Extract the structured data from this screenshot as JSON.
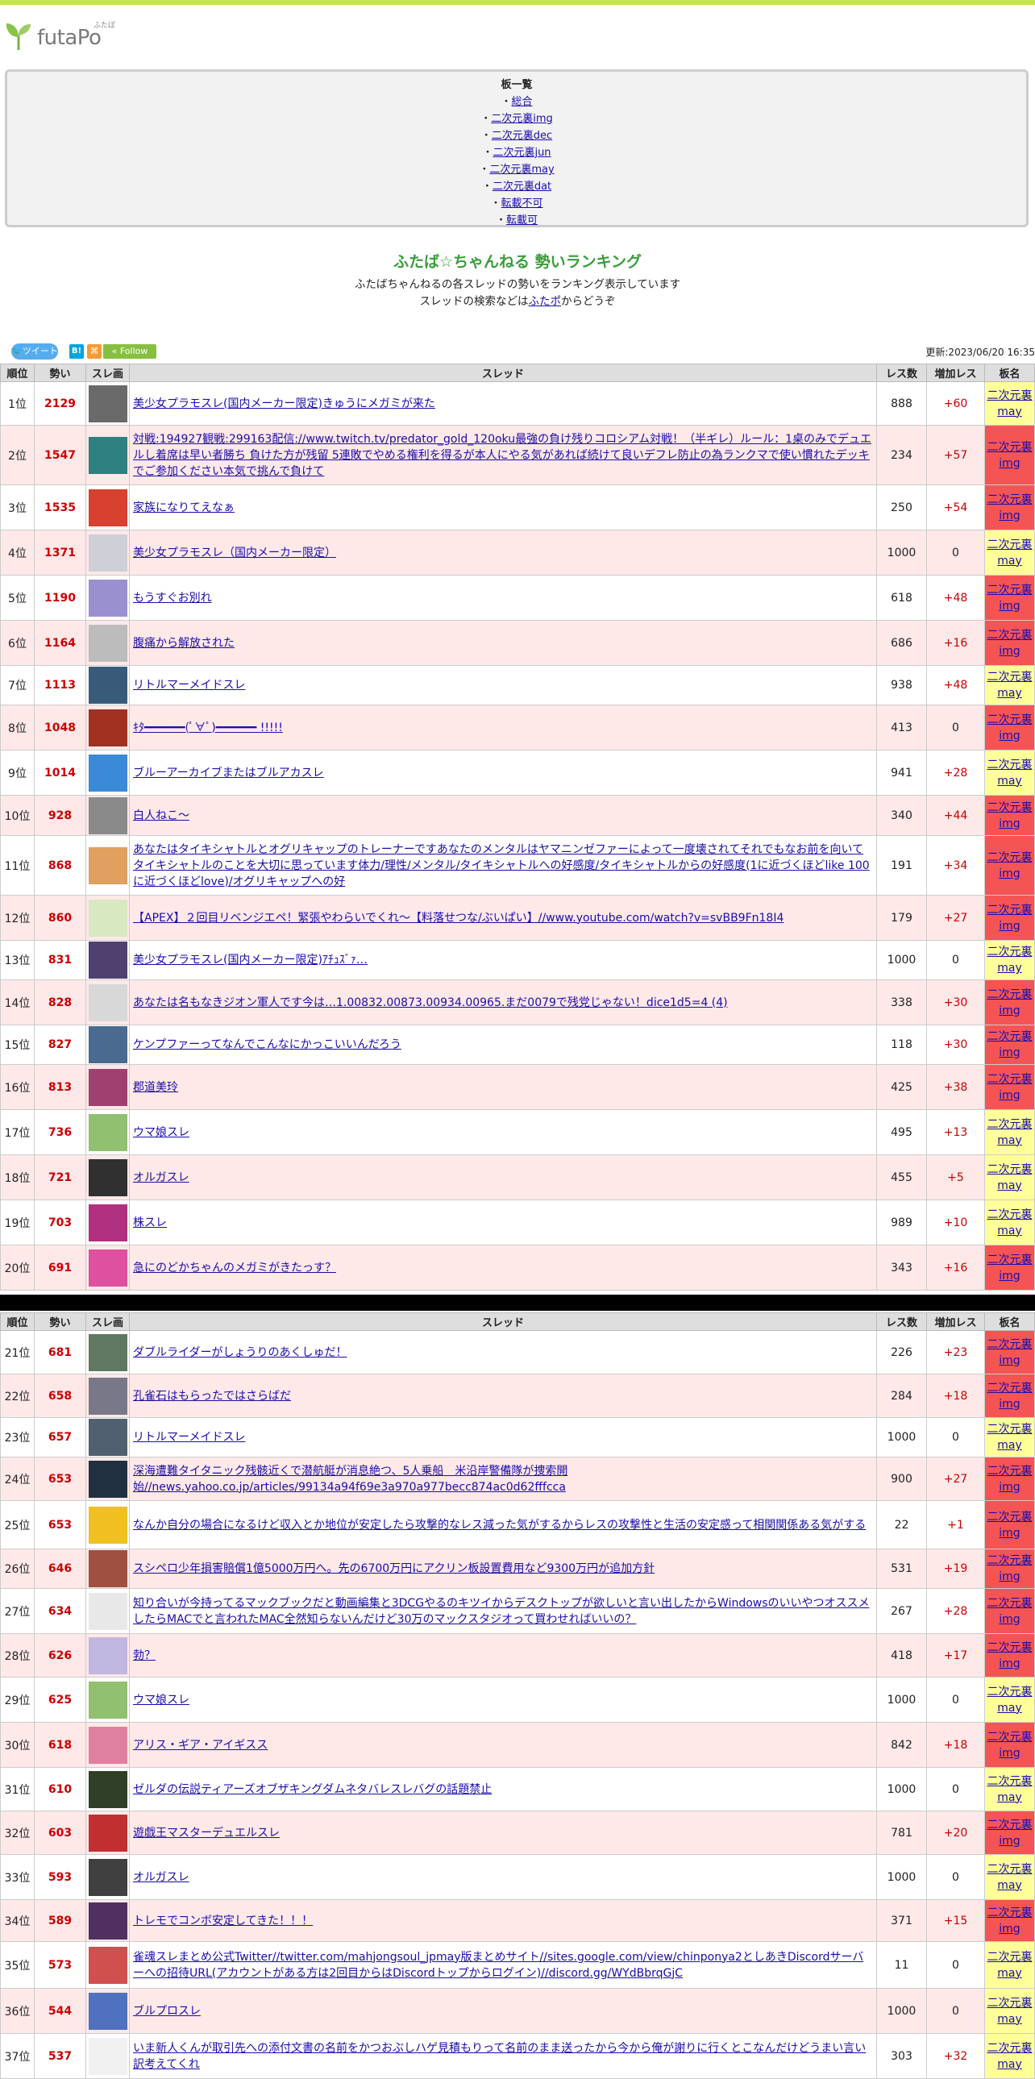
{
  "logo": {
    "text": "futaPo",
    "ruby": "ふたぽ"
  },
  "boards": {
    "title": "板一覧",
    "items": [
      "総合",
      "二次元裏img",
      "二次元裏dec",
      "二次元裏jun",
      "二次元裏may",
      "二次元裏dat",
      "転載不可",
      "転載可"
    ]
  },
  "heading": {
    "title": "ふたば☆ちゃんねる 勢いランキング",
    "line1": "ふたばちゃんねるの各スレッドの勢いをランキング表示しています",
    "line2_pre": "スレッドの検索などは",
    "line2_link": "ふたポ",
    "line2_post": "からどうぞ"
  },
  "social": {
    "tweet": "ツイート",
    "hatena": "B!",
    "rss": "⌘",
    "follow": "Follow"
  },
  "updated": "更新:2023/06/20 16:35",
  "columns": [
    "順位",
    "勢い",
    "スレ画",
    "スレッド",
    "レス数",
    "増加レス",
    "板名"
  ],
  "rows": [
    {
      "rank": "1位",
      "ikioi": "2129",
      "title": "美少女プラモスレ(国内メーカー限定)きゅうにメガミが来た",
      "res": "888",
      "inc": "+60",
      "board": "二次元裏may",
      "thumb": "#6a6a6a"
    },
    {
      "rank": "2位",
      "ikioi": "1547",
      "title": "対戦:194927観戦:299163配信://www.twitch.tv/predator_gold_120oku最強の負け残りコロシアム対戦！（半ギレ）ルール：1桌のみでデュエルし着席は早い者勝ち 負けた方が残留 5連敗でやめる権利を得るが本人にやる気があれば続けて良いデフレ防止の為ランクマで使い慣れたデッキでご参加ください本気で挑んで負けて",
      "res": "234",
      "inc": "+57",
      "board": "二次元裏img",
      "thumb": "#2f8080"
    },
    {
      "rank": "3位",
      "ikioi": "1535",
      "title": "家族になりてえなぁ",
      "res": "250",
      "inc": "+54",
      "board": "二次元裏img",
      "thumb": "#d84030"
    },
    {
      "rank": "4位",
      "ikioi": "1371",
      "title": "美少女プラモスレ（国内メーカー限定）",
      "res": "1000",
      "inc": "0",
      "board": "二次元裏may",
      "thumb": "#cfcfd8"
    },
    {
      "rank": "5位",
      "ikioi": "1190",
      "title": "もうすぐお別れ",
      "res": "618",
      "inc": "+48",
      "board": "二次元裏img",
      "thumb": "#9a90d0"
    },
    {
      "rank": "6位",
      "ikioi": "1164",
      "title": "腹痛から解放された",
      "res": "686",
      "inc": "+16",
      "board": "二次元裏img",
      "thumb": "#bcbcbc"
    },
    {
      "rank": "7位",
      "ikioi": "1113",
      "title": "リトルマーメイドスレ",
      "res": "938",
      "inc": "+48",
      "board": "二次元裏may",
      "thumb": "#3a5a7a"
    },
    {
      "rank": "8位",
      "ikioi": "1048",
      "title": "ｷﾀ━━━━━━(ﾟ∀ﾟ)━━━━━━ !!!!!",
      "res": "413",
      "inc": "0",
      "board": "二次元裏img",
      "thumb": "#a03020"
    },
    {
      "rank": "9位",
      "ikioi": "1014",
      "title": "ブルーアーカイブまたはブルアカスレ",
      "res": "941",
      "inc": "+28",
      "board": "二次元裏may",
      "thumb": "#3a8ad8"
    },
    {
      "rank": "10位",
      "ikioi": "928",
      "title": "白人ねこ〜",
      "res": "340",
      "inc": "+44",
      "board": "二次元裏img",
      "thumb": "#8a8a8a"
    },
    {
      "rank": "11位",
      "ikioi": "868",
      "title": "あなたはタイキシャトルとオグリキャップのトレーナーですあなたのメンタルはヤマニンゼファーによって一度壊されてそれでもなお前を向いてタイキシャトルのことを大切に思っています体力/理性/メンタル/タイキシャトルへの好感度/タイキシャトルからの好感度(1に近づくほどlike 100に近づくほどlove)/オグリキャップへの好",
      "res": "191",
      "inc": "+34",
      "board": "二次元裏img",
      "thumb": "#e0a060"
    },
    {
      "rank": "12位",
      "ikioi": "860",
      "title": "【APEX】２回目リベンジエペ！緊張やわらいでくれ〜【料落せつな/ぶいぱい】//www.youtube.com/watch?v=svBB9Fn18I4",
      "res": "179",
      "inc": "+27",
      "board": "二次元裏img",
      "thumb": "#d8e8c0"
    },
    {
      "rank": "13位",
      "ikioi": "831",
      "title": "美少女プラモスレ(国内メーカー限定)ｱﾁｭｽﾞｧ…",
      "res": "1000",
      "inc": "0",
      "board": "二次元裏may",
      "thumb": "#504070"
    },
    {
      "rank": "14位",
      "ikioi": "828",
      "title": "あなたは名もなきジオン軍人です今は…1.00832.00873.00934.00965.まだ0079で残党じゃない！dice1d5=4 (4)",
      "res": "338",
      "inc": "+30",
      "board": "二次元裏img",
      "thumb": "#d8d8d8"
    },
    {
      "rank": "15位",
      "ikioi": "827",
      "title": "ケンプファーってなんでこんなにかっこいいんだろう",
      "res": "118",
      "inc": "+30",
      "board": "二次元裏img",
      "thumb": "#4a6a90"
    },
    {
      "rank": "16位",
      "ikioi": "813",
      "title": "郡道美玲",
      "res": "425",
      "inc": "+38",
      "board": "二次元裏img",
      "thumb": "#a04070"
    },
    {
      "rank": "17位",
      "ikioi": "736",
      "title": "ウマ娘スレ",
      "res": "495",
      "inc": "+13",
      "board": "二次元裏may",
      "thumb": "#90c070"
    },
    {
      "rank": "18位",
      "ikioi": "721",
      "title": "オルガスレ",
      "res": "455",
      "inc": "+5",
      "board": "二次元裏may",
      "thumb": "#303030"
    },
    {
      "rank": "19位",
      "ikioi": "703",
      "title": "株スレ",
      "res": "989",
      "inc": "+10",
      "board": "二次元裏may",
      "thumb": "#b03080"
    },
    {
      "rank": "20位",
      "ikioi": "691",
      "title": "急にのどかちゃんのメガミがきたっす？",
      "res": "343",
      "inc": "+16",
      "board": "二次元裏img",
      "thumb": "#e050a0"
    },
    {
      "rank": "21位",
      "ikioi": "681",
      "title": "ダブルライダーがしょうりのあくしゅだ！",
      "res": "226",
      "inc": "+23",
      "board": "二次元裏img",
      "thumb": "#607860"
    },
    {
      "rank": "22位",
      "ikioi": "658",
      "title": "孔雀石はもらったではさらばだ",
      "res": "284",
      "inc": "+18",
      "board": "二次元裏img",
      "thumb": "#787888"
    },
    {
      "rank": "23位",
      "ikioi": "657",
      "title": "リトルマーメイドスレ",
      "res": "1000",
      "inc": "0",
      "board": "二次元裏may",
      "thumb": "#506070"
    },
    {
      "rank": "24位",
      "ikioi": "653",
      "title": "深海遭難タイタニック残骸近くで潜航艇が消息絶つ、5人乗船　米沿岸警備隊が捜索開始//news.yahoo.co.jp/articles/99134a94f69e3a970a977becc874ac0d62fffcca",
      "res": "900",
      "inc": "+27",
      "board": "二次元裏img",
      "thumb": "#203040"
    },
    {
      "rank": "25位",
      "ikioi": "653",
      "title": "なんか自分の場合になるけど収入とか地位が安定したら攻撃的なレス減った気がするからレスの攻撃性と生活の安定感って相関関係ある気がする",
      "res": "22",
      "inc": "+1",
      "board": "二次元裏img",
      "thumb": "#f0c020"
    },
    {
      "rank": "26位",
      "ikioi": "646",
      "title": "スシペロ少年損害賠償1億5000万円へ。先の6700万円にアクリン板設置費用など9300万円が追加方針",
      "res": "531",
      "inc": "+19",
      "board": "二次元裏img",
      "thumb": "#a05040"
    },
    {
      "rank": "27位",
      "ikioi": "634",
      "title": "知り合いが今持ってるマックブックだと動画編集と3DCGやるのキツイからデスクトップが欲しいと言い出したからWindowsのいいやつオススメしたらMACでと言われたMAC全然知らないんだけど30万のマックスタジオって買わせればいいの？",
      "res": "267",
      "inc": "+28",
      "board": "二次元裏img",
      "thumb": "#e8e8e8"
    },
    {
      "rank": "28位",
      "ikioi": "626",
      "title": "勃？",
      "res": "418",
      "inc": "+17",
      "board": "二次元裏img",
      "thumb": "#c0b8e0"
    },
    {
      "rank": "29位",
      "ikioi": "625",
      "title": "ウマ娘スレ",
      "res": "1000",
      "inc": "0",
      "board": "二次元裏may",
      "thumb": "#90c070"
    },
    {
      "rank": "30位",
      "ikioi": "618",
      "title": "アリス・ギア・アイギスス",
      "res": "842",
      "inc": "+18",
      "board": "二次元裏img",
      "thumb": "#e080a0"
    },
    {
      "rank": "31位",
      "ikioi": "610",
      "title": "ゼルダの伝説ティアーズオブザキングダムネタバレスレバグの話題禁止",
      "res": "1000",
      "inc": "0",
      "board": "二次元裏may",
      "thumb": "#304028"
    },
    {
      "rank": "32位",
      "ikioi": "603",
      "title": "遊戯王マスターデュエルスレ",
      "res": "781",
      "inc": "+20",
      "board": "二次元裏img",
      "thumb": "#c03030"
    },
    {
      "rank": "33位",
      "ikioi": "593",
      "title": "オルガスレ",
      "res": "1000",
      "inc": "0",
      "board": "二次元裏may",
      "thumb": "#404040"
    },
    {
      "rank": "34位",
      "ikioi": "589",
      "title": "トレモでコンボ安定してきた！！！",
      "res": "371",
      "inc": "+15",
      "board": "二次元裏img",
      "thumb": "#503060"
    },
    {
      "rank": "35位",
      "ikioi": "573",
      "title": "雀魂スレまとめ公式Twitter//twitter.com/mahjongsoul_jpmay版まとめサイト//sites.google.com/view/chinponya2としあきDiscordサーバーへの招待URL(アカウントがある方は2回目からはDiscordトップからログイン)//discord.gg/WYdBbrqGjC",
      "res": "11",
      "inc": "0",
      "board": "二次元裏may",
      "thumb": "#d05050"
    },
    {
      "rank": "36位",
      "ikioi": "544",
      "title": "ブルプロスレ",
      "res": "1000",
      "inc": "0",
      "board": "二次元裏may",
      "thumb": "#5070c0"
    },
    {
      "rank": "37位",
      "ikioi": "537",
      "title": "いま新人くんが取引先への添付文書の名前をかつおぶしハゲ見積もりって名前のまま送ったから今から俺が謝りに行くとこなんだけどうまい言い訳考えてくれ",
      "res": "303",
      "inc": "+32",
      "board": "二次元裏may",
      "thumb": "#f0f0f0"
    }
  ]
}
